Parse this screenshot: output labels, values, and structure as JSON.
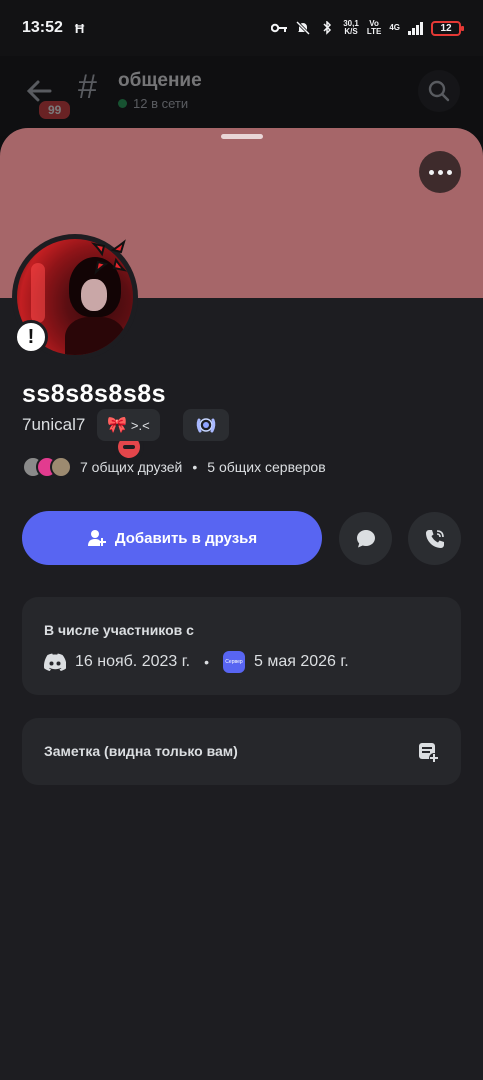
{
  "status_bar": {
    "time": "13:52",
    "app_glyph": "Ħ",
    "network_speed": "30,1",
    "network_unit": "K/S",
    "volte_top": "Vo",
    "volte_bottom": "LTE",
    "network_type": "4G",
    "battery_level": "12",
    "battery_color": "#e53935"
  },
  "background_header": {
    "unread_badge": "99",
    "channel_name": "общение",
    "online_count": "12 в сети"
  },
  "profile": {
    "banner_color": "#a66669",
    "display_name": "ss8s8s8s8s",
    "username": "7unical7",
    "tag_text": ">.<",
    "status": "dnd",
    "status_color": "#e4464b",
    "mutual_friends": "7 общих друзей",
    "mutual_separator": "•",
    "mutual_servers": "5 общих серверов"
  },
  "actions": {
    "add_friend_label": "Добавить в друзья",
    "accent_color": "#5865f2"
  },
  "member_since": {
    "title": "В числе участников с",
    "discord_date": "16 нояб. 2023 г.",
    "separator": "•",
    "server_icon_text": "Сервер",
    "server_date": "5 мая 2026 г."
  },
  "note": {
    "label": "Заметка (видна только вам)"
  },
  "icons": {
    "back": "arrow-left-icon",
    "channel": "hash-icon",
    "search": "search-icon",
    "more": "more-dots-icon",
    "add_friend": "add-friend-icon",
    "message": "message-bubble-icon",
    "call": "phone-call-icon",
    "discord": "discord-logo-icon",
    "note": "note-add-icon"
  }
}
